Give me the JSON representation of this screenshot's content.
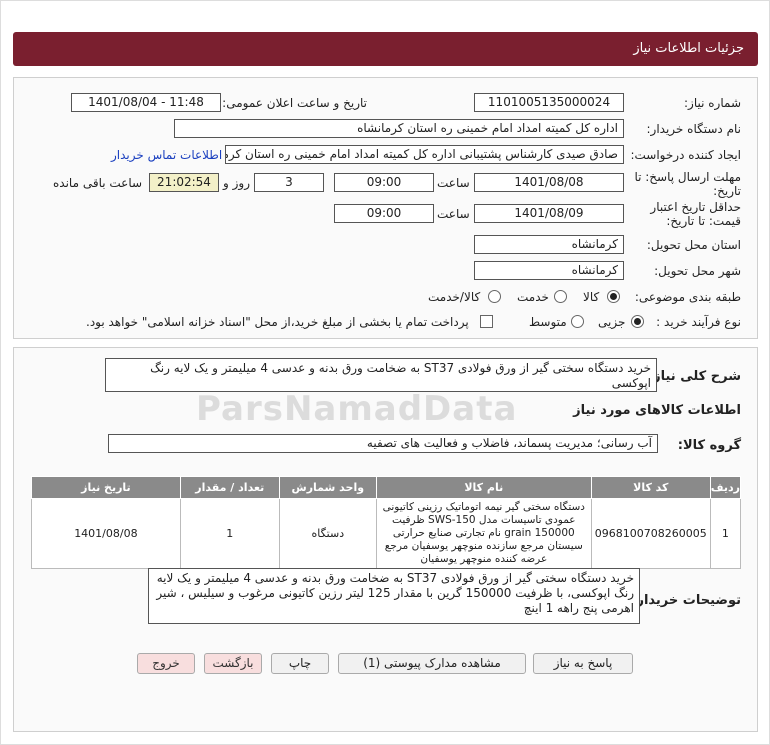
{
  "header": {
    "title": "جزئیات اطلاعات نیاز"
  },
  "fields": {
    "need_number_label": "شماره نیاز:",
    "need_number": "1101005135000024",
    "announce_label": "تاریخ و ساعت اعلان عمومی:",
    "announce_value": "1401/08/04 - 11:48",
    "buyer_org_label": "نام دستگاه خریدار:",
    "buyer_org": "اداره کل کمیته امداد امام خمینی  ره  استان کرمانشاه",
    "requester_label": "ایجاد کننده درخواست:",
    "requester": "صادق  صیدی  کارشناس پشتیبانی  اداره کل کمیته امداد امام خمینی  ره  استان کرمانشاه",
    "contact_link": "اطلاعات تماس خریدار",
    "deadline_label": "مهلت ارسال پاسخ: تا",
    "deadline_label2": "تاریخ:",
    "deadline_date": "1401/08/08",
    "time_label": "ساعت",
    "deadline_time": "09:00",
    "days_value": "3",
    "days_label": "روز و",
    "remaining_time": "21:02:54",
    "remaining_label": "ساعت باقی مانده",
    "validity_label": "حداقل تاریخ اعتبار",
    "validity_label2": "قیمت: تا تاریخ:",
    "validity_date": "1401/08/09",
    "validity_time_label": "ساعت",
    "validity_time": "09:00",
    "delivery_province_label": "استان محل تحویل:",
    "delivery_province": "کرمانشاه",
    "delivery_city_label": "شهر محل تحویل:",
    "delivery_city": "کرمانشاه",
    "category_label": "طبقه بندی موضوعی:",
    "category_options": [
      "کالا",
      "خدمت",
      "کالا/خدمت"
    ],
    "process_label": "نوع فرآیند خرید :",
    "process_options": [
      "جزیی",
      "متوسط"
    ],
    "payment_note": "پرداخت تمام یا بخشی از مبلغ خرید،از محل \"اسناد خزانه اسلامی\" خواهد بود."
  },
  "summary": {
    "label": "شرح کلی نیاز:",
    "text": "خرید دستگاه سختی گیر از ورق فولادی ST37 به ضخامت ورق بدنه و عدسی 4 میلیمتر و یک لایه رنگ اپوکسی"
  },
  "goods_info_title": "اطلاعات کالاهای مورد نیاز",
  "goods_group": {
    "label": "گروه کالا:",
    "value": "آب رسانی؛ مدیریت پسماند، فاضلاب و فعالیت های تصفیه"
  },
  "table": {
    "headers": [
      "ردیف",
      "کد کالا",
      "نام کالا",
      "واحد شمارش",
      "تعداد / مقدار",
      "تاریخ نیاز"
    ],
    "rows": [
      {
        "index": "1",
        "code": "0968100708260005",
        "name": "دستگاه سختی گیر نیمه اتوماتیک رزینی کاتیونی عمودی تاسیسات مدل SWS-150 ظرفیت grain 150000 نام تجارتی صنایع حرارتی سیستان مرجع سازنده منوچهر یوسفیان مرجع عرضه کننده منوچهر یوسفیان",
        "unit": "دستگاه",
        "qty": "1",
        "date": "1401/08/08"
      }
    ]
  },
  "buyer_desc": {
    "label": "توضیحات خریدار:",
    "text": "خرید دستگاه سختی گیر از ورق فولادی ST37 به ضخامت ورق بدنه و عدسی 4 میلیمتر و یک لایه رنگ اپوکسی، با ظرفیت 150000 گرین با مقدار 125 لیتر رزین کاتیونی مرغوب و سیلیس ، شیر اهرمی پنج راهه 1 اینچ"
  },
  "buttons": {
    "reply": "پاسخ به نیاز",
    "attachments": "مشاهده مدارک پیوستی (1)",
    "print": "چاپ",
    "back": "بازگشت",
    "exit": "خروج"
  },
  "watermark": "ParsNamadData"
}
